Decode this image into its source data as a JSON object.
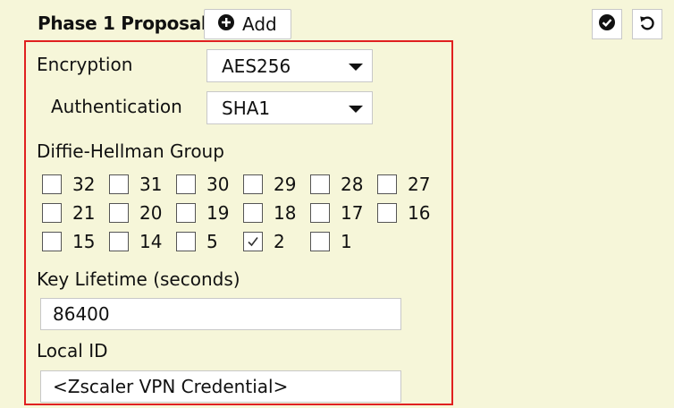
{
  "header": {
    "title": "Phase 1 Proposal",
    "add_label": "Add",
    "apply_icon": "check-circle-icon",
    "revert_icon": "undo-icon"
  },
  "form": {
    "encryption_label": "Encryption",
    "encryption_value": "AES256",
    "authentication_label": "Authentication",
    "authentication_value": "SHA1",
    "dh_label": "Diffie-Hellman Group",
    "dh_groups": [
      {
        "value": "32",
        "checked": false
      },
      {
        "value": "31",
        "checked": false
      },
      {
        "value": "30",
        "checked": false
      },
      {
        "value": "29",
        "checked": false
      },
      {
        "value": "28",
        "checked": false
      },
      {
        "value": "27",
        "checked": false
      },
      {
        "value": "21",
        "checked": false
      },
      {
        "value": "20",
        "checked": false
      },
      {
        "value": "19",
        "checked": false
      },
      {
        "value": "18",
        "checked": false
      },
      {
        "value": "17",
        "checked": false
      },
      {
        "value": "16",
        "checked": false
      },
      {
        "value": "15",
        "checked": false
      },
      {
        "value": "14",
        "checked": false
      },
      {
        "value": "5",
        "checked": false
      },
      {
        "value": "2",
        "checked": true
      },
      {
        "value": "1",
        "checked": false
      }
    ],
    "key_lifetime_label": "Key Lifetime (seconds)",
    "key_lifetime_value": "86400",
    "local_id_label": "Local ID",
    "local_id_value": "<Zscaler VPN Credential>"
  },
  "colors": {
    "background": "#f6f6d9",
    "highlight_border": "#e02020"
  }
}
